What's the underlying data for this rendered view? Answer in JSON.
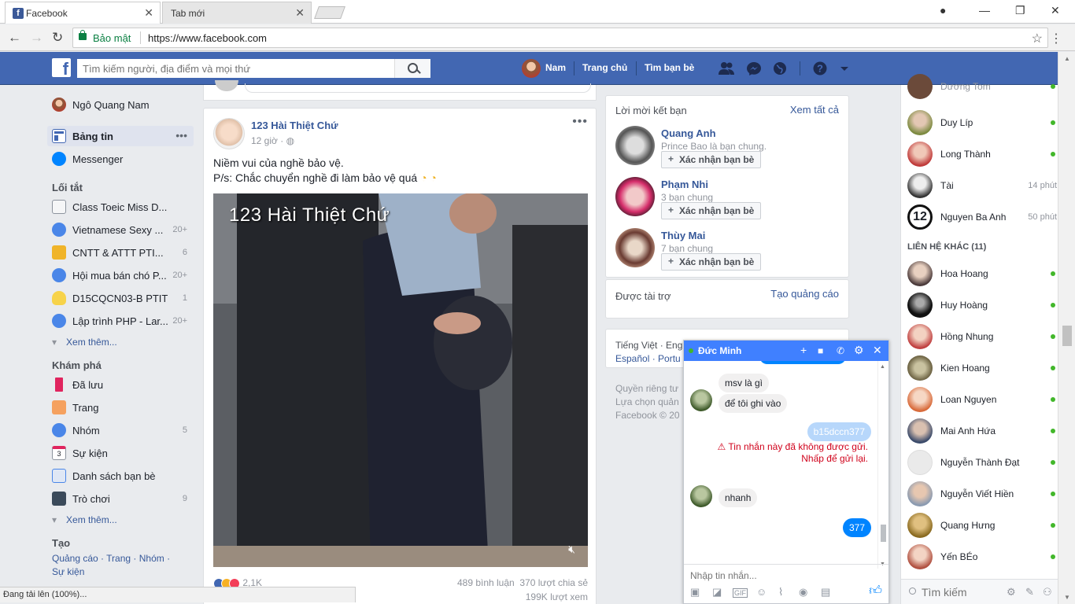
{
  "browser": {
    "tabs": [
      {
        "label": "Facebook",
        "active": true
      },
      {
        "label": "Tab mới",
        "active": false
      }
    ],
    "secure_label": "Bảo mật",
    "url": "https://www.facebook.com",
    "status": "Đang tải lên (100%)..."
  },
  "fb": {
    "logo": "f",
    "search_placeholder": "Tìm kiếm người, địa điểm và mọi thứ",
    "user_short": "Nam",
    "nav_home": "Trang chủ",
    "nav_friends": "Tìm bạn bè"
  },
  "leftnav": {
    "profile": "Ngô Quang Nam",
    "feed": "Bảng tin",
    "messenger": "Messenger",
    "shortcuts_title": "Lối tắt",
    "shortcuts": [
      {
        "label": "Class Toeic Miss D...",
        "count": ""
      },
      {
        "label": "Vietnamese Sexy ...",
        "count": "20+"
      },
      {
        "label": "CNTT & ATTT PTI...",
        "count": "6"
      },
      {
        "label": "Hội mua bán chó P...",
        "count": "20+"
      },
      {
        "label": "D15CQCN03-B PTIT",
        "count": "1"
      },
      {
        "label": "Lập trình PHP - Lar...",
        "count": "20+"
      }
    ],
    "see_more": "Xem thêm...",
    "explore_title": "Khám phá",
    "explore": [
      {
        "label": "Đã lưu",
        "count": ""
      },
      {
        "label": "Trang",
        "count": ""
      },
      {
        "label": "Nhóm",
        "count": "5"
      },
      {
        "label": "Sự kiện",
        "count": ""
      },
      {
        "label": "Danh sách bạn bè",
        "count": ""
      },
      {
        "label": "Trò chơi",
        "count": "9"
      }
    ],
    "see_more2": "Xem thêm...",
    "create_title": "Tạo",
    "create_links": "Quảng cáo · Trang · Nhóm ·",
    "create_links2": "Sự kiện"
  },
  "post": {
    "author": "123 Hài Thiệt Chứ",
    "time": "12 giờ · ",
    "text1": "Niềm vui của nghề bảo vệ.",
    "text2": "P/s: Chắc chuyển nghề đi làm bảo vệ quá",
    "video_overlay": "123 Hài Thiệt Chứ",
    "reactions": "2,1K",
    "comments": "489 bình luận",
    "shares": "370 lượt chia sẻ",
    "views": "199K lượt xem"
  },
  "right": {
    "friend_requests_title": "Lời mời kết bạn",
    "see_all": "Xem tất cả",
    "requests": [
      {
        "name": "Quang Anh",
        "mutual": "Prince Bao là bạn chung."
      },
      {
        "name": "Phạm Nhi",
        "mutual": "3 bạn chung"
      },
      {
        "name": "Thùy Mai",
        "mutual": "7 bạn chung"
      }
    ],
    "confirm_label": "Xác nhận bạn bè",
    "sponsored": "Được tài trợ",
    "create_ad": "Tạo quảng cáo",
    "lang1": "Tiếng Việt · Eng",
    "lang2": "Español · Portu",
    "foot1": "Quyền riêng tư",
    "foot2": "Lựa chọn quản",
    "foot3": "Facebook © 20"
  },
  "chat": {
    "top_partial": "Dương Tom",
    "contacts": [
      {
        "name": "Duy Líp",
        "ago": ""
      },
      {
        "name": "Long Thành",
        "ago": ""
      },
      {
        "name": "Tài",
        "ago": "14 phút"
      },
      {
        "name": "Nguyen Ba Anh",
        "ago": "50 phút"
      }
    ],
    "other_title": "LIÊN HỆ KHÁC (11)",
    "others": [
      "Hoa Hoang",
      "Huy Hoàng",
      "Hồng Nhung",
      "Kien Hoang",
      "Loan Nguyen",
      "Mai Anh Hứa",
      "Nguyễn Thành Đạt",
      "Nguyễn Viết Hiền",
      "Quang Hưng",
      "Yến BÉo"
    ],
    "search_placeholder": "Tìm kiếm"
  },
  "chatwin": {
    "name": "Đức Minh",
    "msg1": "msv là gì",
    "msg2": "để tôi ghi vào",
    "msg3": "b15dccn377",
    "error1": "⚠ Tin nhắn này đã không được gửi.",
    "error2": "Nhấp để gửi lại.",
    "msg4": "nhanh",
    "msg5": "377",
    "compose_placeholder": "Nhập tin nhắn..."
  }
}
